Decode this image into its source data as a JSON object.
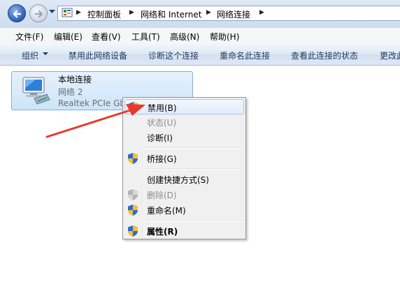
{
  "address": {
    "crumbs": [
      "控制面板",
      "网络和 Internet",
      "网络连接"
    ]
  },
  "menubar": {
    "items": [
      "文件(F)",
      "编辑(E)",
      "查看(V)",
      "工具(T)",
      "高级(N)",
      "帮助(H)"
    ]
  },
  "commandbar": {
    "items": [
      "组织",
      "禁用此网络设备",
      "诊断这个连接",
      "重命名此连接",
      "查看此连接的状态",
      "更改此"
    ]
  },
  "connection": {
    "name": "本地连接",
    "network": "网络  2",
    "device": "Realtek PCIe GbE"
  },
  "context_menu": {
    "items": [
      {
        "label": "禁用(B)",
        "state": "hover",
        "icon": "shield-icon"
      },
      {
        "label": "状态(U)",
        "state": "disabled"
      },
      {
        "label": "诊断(I)",
        "state": "normal"
      },
      {
        "label": "桥接(G)",
        "state": "normal",
        "icon": "shield-icon"
      },
      {
        "label": "创建快捷方式(S)",
        "state": "normal"
      },
      {
        "label": "删除(D)",
        "state": "disabled",
        "icon": "shield-icon"
      },
      {
        "label": "重命名(M)",
        "state": "normal",
        "icon": "shield-icon"
      },
      {
        "label": "属性(R)",
        "state": "bold",
        "icon": "shield-icon"
      }
    ]
  },
  "colors": {
    "annotation_arrow": "#e8392c",
    "selection_border": "#84acdd",
    "command_text": "#1e395b"
  }
}
